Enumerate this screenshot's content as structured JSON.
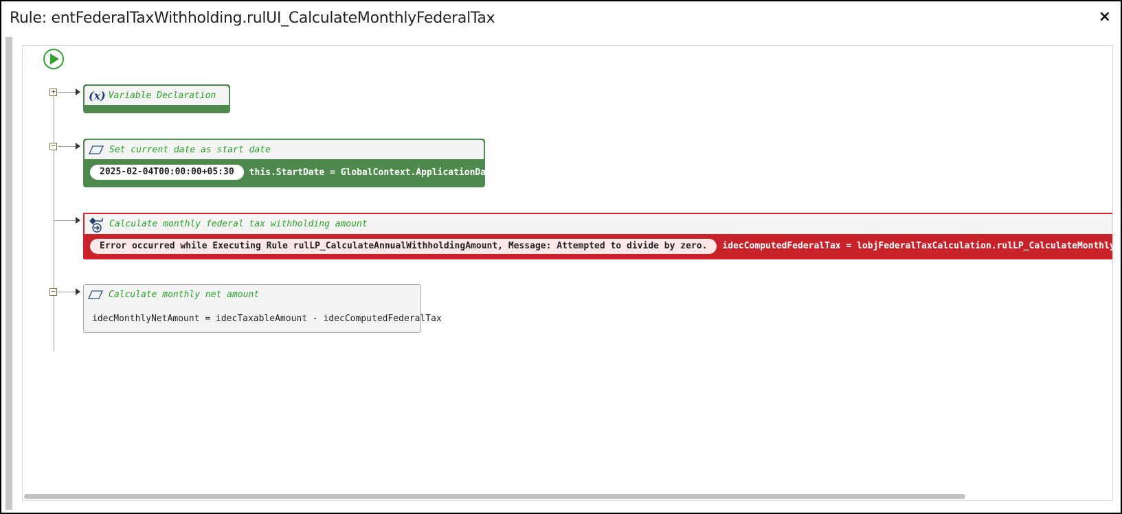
{
  "window": {
    "title": "Rule: entFederalTaxWithholding.rulUI_CalculateMonthlyFederalTax",
    "close_glyph": "×"
  },
  "icons": {
    "start": "play-icon",
    "variable": "variable-x-icon",
    "assign": "parallelogram-icon",
    "call": "method-call-icon"
  },
  "colors": {
    "success": "#4e8a4e",
    "error": "#c8232b",
    "title_text": "#28a028"
  },
  "nodes": [
    {
      "title": "Variable Declaration",
      "variable_glyph": "(x)",
      "status": "success"
    },
    {
      "title": "Set current date as start date",
      "value": "2025-02-04T00:00:00+05:30",
      "expression": "this.StartDate = GlobalContext.ApplicationDate",
      "status": "success"
    },
    {
      "title": "Calculate monthly federal tax withholding amount",
      "value": "Error occurred while Executing Rule rulLP_CalculateAnnualWithholdingAmount, Message: Attempted to divide by zero.",
      "expression": "idecComputedFederalTax = lobjFederalTaxCalculation.rulLP_CalculateMonthlyFederalTax",
      "status": "error"
    },
    {
      "title": "Calculate monthly net amount",
      "expression": "idecMonthlyNetAmount = idecTaxableAmount - idecComputedFederalTax",
      "status": "not-executed"
    }
  ]
}
